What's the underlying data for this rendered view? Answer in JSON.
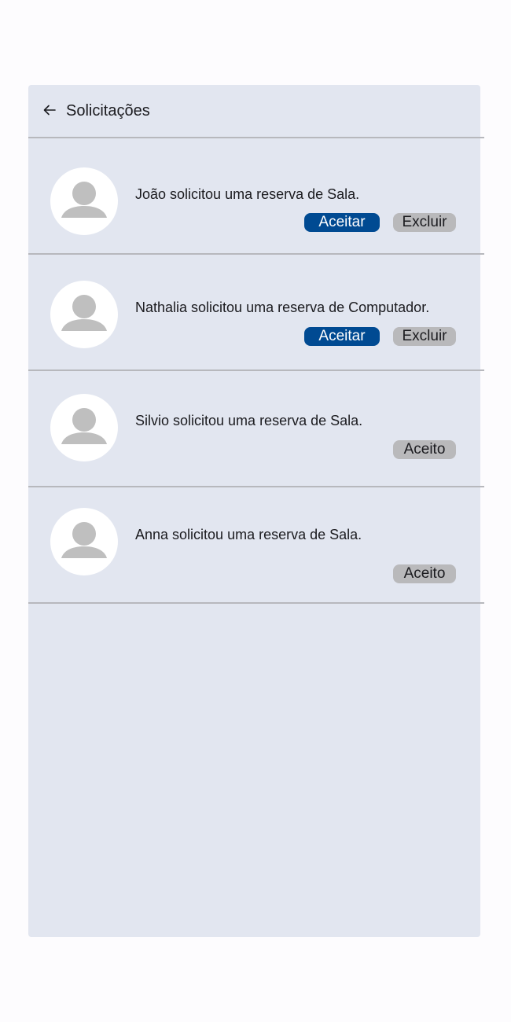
{
  "header": {
    "title": "Solicitações"
  },
  "requests": [
    {
      "message": "João solicitou uma reserva de Sala.",
      "accept_label": "Aceitar",
      "delete_label": "Excluir"
    },
    {
      "message": "Nathalia solicitou uma reserva de Computador.",
      "accept_label": "Aceitar",
      "delete_label": "Excluir"
    },
    {
      "message": "Silvio solicitou uma reserva de Sala.",
      "status": "Aceito"
    },
    {
      "message": "Anna solicitou uma reserva de Sala.",
      "status": "Aceito"
    }
  ],
  "colors": {
    "panel_bg": "#e2e6f0",
    "accept_button": "#004a92",
    "neutral_button": "#b9b9bb",
    "divider": "#b7b8bd"
  }
}
